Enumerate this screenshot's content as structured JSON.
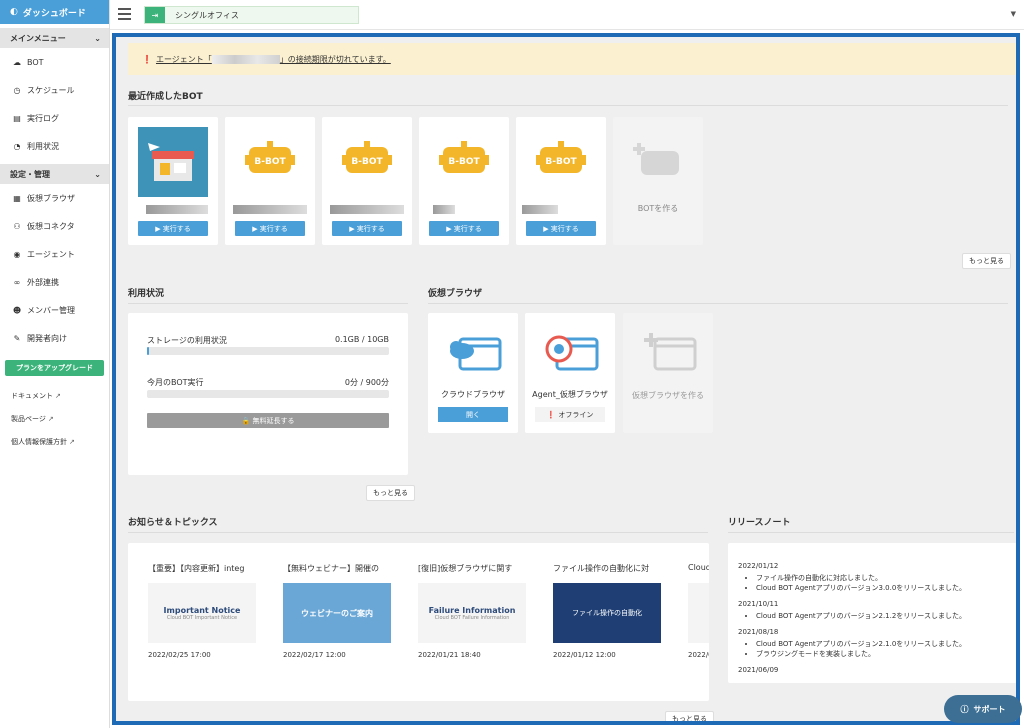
{
  "sidebar": {
    "dashboard": "ダッシュボード",
    "main_menu": "メインメニュー",
    "main_items": [
      {
        "label": "BOT"
      },
      {
        "label": "スケジュール"
      },
      {
        "label": "実行ログ"
      },
      {
        "label": "利用状況"
      }
    ],
    "settings": "設定・管理",
    "settings_items": [
      {
        "label": "仮想ブラウザ"
      },
      {
        "label": "仮想コネクタ"
      },
      {
        "label": "エージェント"
      },
      {
        "label": "外部連携"
      },
      {
        "label": "メンバー管理"
      },
      {
        "label": "開発者向け"
      }
    ],
    "upgrade": "プランをアップグレード",
    "links": [
      {
        "label": "ドキュメント"
      },
      {
        "label": "製品ページ"
      },
      {
        "label": "個人情報保護方針"
      }
    ]
  },
  "topbar": {
    "office": "シングルオフィス"
  },
  "alert": {
    "prefix": "エージェント「",
    "suffix": "」の接続期限が切れています。"
  },
  "recent_bots": {
    "title": "最近作成したBOT",
    "run_label": "▶ 実行する",
    "logo_text": "B-BOT",
    "create_label": "BOTを作る",
    "more": "もっと見る"
  },
  "usage": {
    "title": "利用状況",
    "storage_label": "ストレージの利用状況",
    "storage_value": "0.1GB / 10GB",
    "storage_fraction": 0.01,
    "bot_label": "今月のBOT実行",
    "bot_value": "0分 / 900分",
    "bot_fraction": 0,
    "extend": "🔒 無料延長する",
    "more": "もっと見る"
  },
  "vbrowser": {
    "title": "仮想ブラウザ",
    "cloud_name": "クラウドブラウザ",
    "open": "開く",
    "agent_name": "Agent_仮想ブラウザ",
    "offline": "オフライン",
    "create": "仮想ブラウザを作る"
  },
  "news": {
    "title": "お知らせ＆トピックス",
    "items": [
      {
        "title": "【重要】【内容更新】integ",
        "thumb1": "Important Notice",
        "thumb2": "Cloud BOT Important Notice",
        "date": "2022/02/25 17:00"
      },
      {
        "title": "【無料ウェビナー】開催の",
        "thumb1": "ウェビナーのご案内",
        "thumb2": "",
        "date": "2022/02/17 12:00"
      },
      {
        "title": "[復旧]仮想ブラウザに関す",
        "thumb1": "Failure Information",
        "thumb2": "Cloud BOT Failure Information",
        "date": "2022/01/21 18:40"
      },
      {
        "title": "ファイル操作の自動化に対",
        "thumb1": "ファイル操作の自動化",
        "thumb2": "",
        "date": "2022/01/12 12:00"
      },
      {
        "title": "Cloud",
        "thumb1": "",
        "thumb2": "",
        "date": "2022/0"
      }
    ],
    "more": "もっと見る"
  },
  "release": {
    "title": "リリースノート",
    "entries": [
      {
        "date": "2022/01/12",
        "notes": [
          "ファイル操作の自動化に対応しました。",
          "Cloud BOT Agentアプリのバージョン3.0.0をリリースしました。"
        ]
      },
      {
        "date": "2021/10/11",
        "notes": [
          "Cloud BOT Agentアプリのバージョン2.1.2をリリースしました。"
        ]
      },
      {
        "date": "2021/08/18",
        "notes": [
          "Cloud BOT Agentアプリのバージョン2.1.0をリリースしました。",
          "ブラウジングモードを実装しました。"
        ]
      },
      {
        "date": "2021/06/09",
        "notes": []
      }
    ]
  },
  "support": "サポート",
  "colors": {
    "accent": "#4a9fd8",
    "frame": "#1e6ab5",
    "green": "#3bb37a",
    "bot_yellow": "#f3b62b"
  }
}
